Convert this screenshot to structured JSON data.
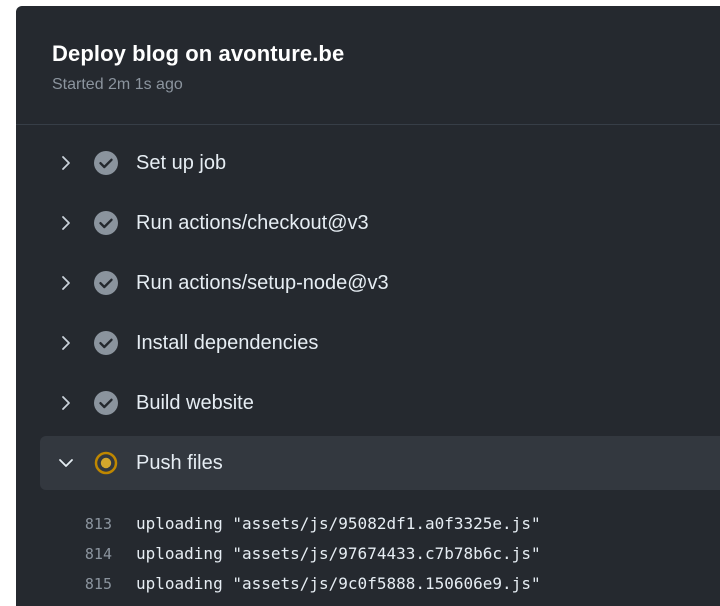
{
  "job": {
    "title": "Deploy blog on avonture.be",
    "subtitle": "Started 2m 1s ago"
  },
  "steps": [
    {
      "label": "Set up job",
      "status": "success",
      "icon": "check-circle-icon",
      "expanded": false
    },
    {
      "label": "Run actions/checkout@v3",
      "status": "success",
      "icon": "check-circle-icon",
      "expanded": false
    },
    {
      "label": "Run actions/setup-node@v3",
      "status": "success",
      "icon": "check-circle-icon",
      "expanded": false
    },
    {
      "label": "Install dependencies",
      "status": "success",
      "icon": "check-circle-icon",
      "expanded": false
    },
    {
      "label": "Build website",
      "status": "success",
      "icon": "check-circle-icon",
      "expanded": false
    },
    {
      "label": "Push files",
      "status": "in-progress",
      "icon": "in-progress-icon",
      "expanded": true
    }
  ],
  "log": [
    {
      "num": "813",
      "text": "uploading \"assets/js/95082df1.a0f3325e.js\""
    },
    {
      "num": "814",
      "text": "uploading \"assets/js/97674433.c7b78b6c.js\""
    },
    {
      "num": "815",
      "text": "uploading \"assets/js/9c0f5888.150606e9.js\""
    }
  ],
  "colors": {
    "panel_bg": "#25292f",
    "expanded_bg": "#33383f",
    "success": "#8b949e",
    "in_progress": "#bf8700"
  }
}
